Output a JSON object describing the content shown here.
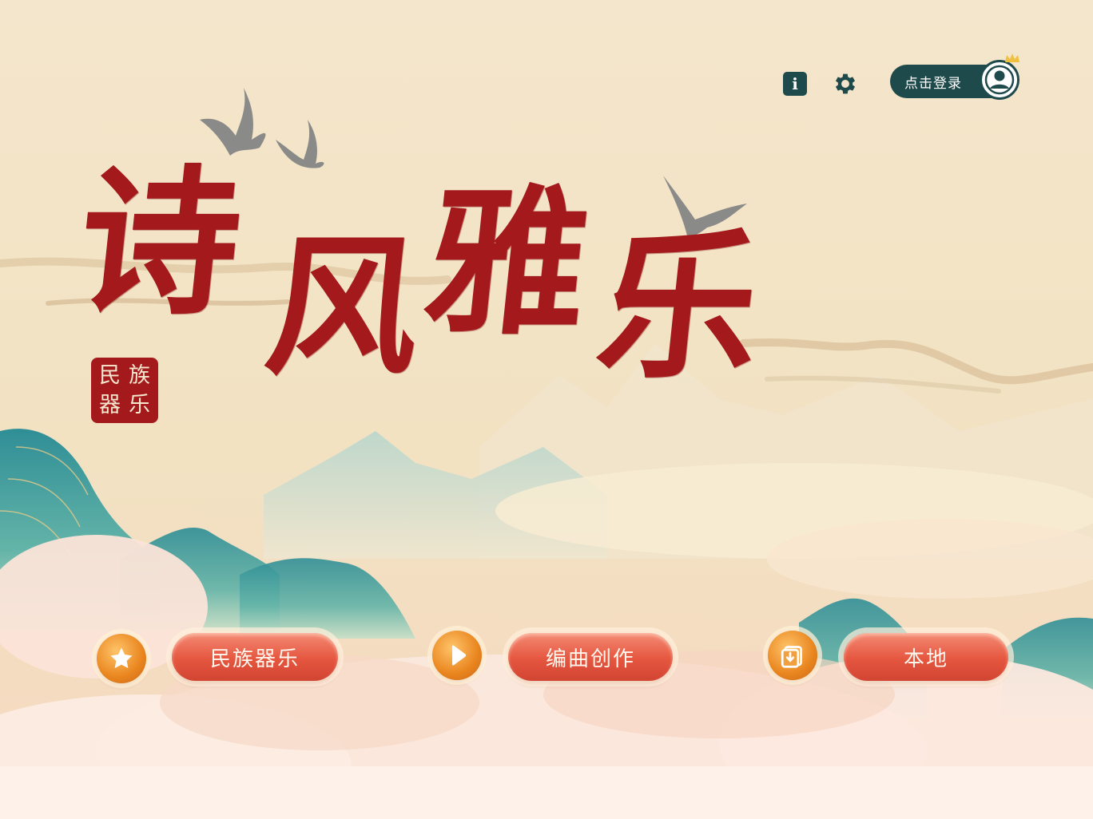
{
  "header": {
    "info_label": "i",
    "login_label": "点击登录"
  },
  "title": {
    "chars": [
      "诗",
      "风",
      "雅",
      "乐"
    ]
  },
  "seal": {
    "chars": [
      "族",
      "民",
      "乐",
      "器"
    ]
  },
  "menu": {
    "folk_instruments_label": "民族器乐",
    "compose_label": "编曲创作",
    "local_label": "本地"
  },
  "icons": {
    "info": "info-icon",
    "settings": "gear-icon",
    "avatar": "user-icon",
    "folk": "star-icon",
    "compose": "play-icon",
    "local": "download-icon"
  },
  "colors": {
    "title_red": "#a3191c",
    "header_teal": "#1e4a4c",
    "button_red": "#e5563f",
    "icon_orange": "#e9851e",
    "background": "#f3e4c8"
  }
}
